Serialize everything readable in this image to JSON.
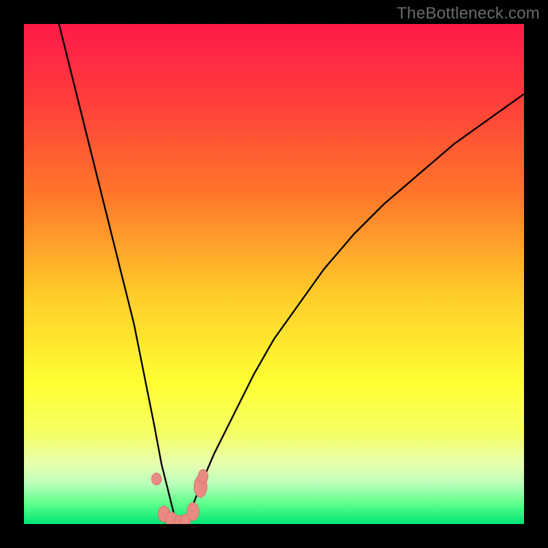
{
  "watermark": {
    "text": "TheBottleneck.com"
  },
  "colors": {
    "frame": "#000000",
    "gradient_stops": [
      {
        "offset": 0.0,
        "color": "#ff1a49"
      },
      {
        "offset": 0.15,
        "color": "#ff3d3b"
      },
      {
        "offset": 0.35,
        "color": "#ff7a2a"
      },
      {
        "offset": 0.55,
        "color": "#ffcf2a"
      },
      {
        "offset": 0.72,
        "color": "#ffff33"
      },
      {
        "offset": 0.82,
        "color": "#f5ff66"
      },
      {
        "offset": 0.88,
        "color": "#e7ffb0"
      },
      {
        "offset": 0.92,
        "color": "#b8ffb8"
      },
      {
        "offset": 0.96,
        "color": "#5cff8c"
      },
      {
        "offset": 1.0,
        "color": "#00e676"
      }
    ],
    "curve": "#000000",
    "marker_fill": "#e98b83",
    "marker_stroke": "#d46e66"
  },
  "chart_data": {
    "type": "line",
    "title": "",
    "xlabel": "",
    "ylabel": "",
    "xlim": [
      0,
      100
    ],
    "ylim": [
      0,
      100
    ],
    "grid": false,
    "legend": false,
    "description": "V-shaped bottleneck curve reaching 0 at the balance point, rising steeply on the left and more gradually on the right. Background is a vertical red→yellow→green gradient (green near y=0).",
    "series": [
      {
        "name": "bottleneck-curve",
        "x": [
          7,
          10,
          13,
          16,
          19,
          22,
          24,
          26,
          27.5,
          29,
          30,
          31,
          32,
          33.5,
          35,
          38,
          42,
          46,
          50,
          55,
          60,
          66,
          72,
          79,
          86,
          93,
          100
        ],
        "y": [
          100,
          88,
          76,
          64,
          52,
          40,
          30,
          20,
          12,
          6,
          2,
          0,
          0,
          3,
          7,
          14,
          22,
          30,
          37,
          44,
          51,
          58,
          64,
          70,
          76,
          81,
          86
        ]
      }
    ],
    "markers": [
      {
        "x": 26.5,
        "y": 9.0,
        "rx": 1.0,
        "ry": 1.2
      },
      {
        "x": 28.0,
        "y": 2.0,
        "rx": 1.2,
        "ry": 1.6
      },
      {
        "x": 29.5,
        "y": 0.8,
        "rx": 1.2,
        "ry": 1.6
      },
      {
        "x": 31.0,
        "y": 0.4,
        "rx": 1.0,
        "ry": 1.4
      },
      {
        "x": 32.3,
        "y": 0.6,
        "rx": 1.0,
        "ry": 1.4
      },
      {
        "x": 33.8,
        "y": 2.5,
        "rx": 1.2,
        "ry": 1.8
      },
      {
        "x": 35.3,
        "y": 7.5,
        "rx": 1.3,
        "ry": 2.2
      },
      {
        "x": 35.8,
        "y": 9.5,
        "rx": 1.0,
        "ry": 1.4
      }
    ]
  }
}
